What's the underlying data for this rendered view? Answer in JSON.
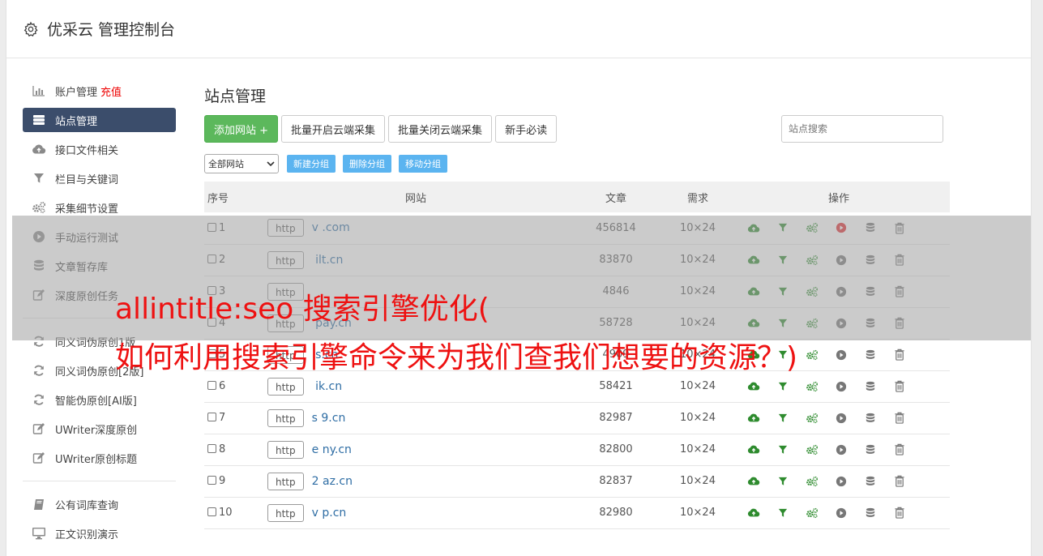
{
  "header": {
    "title": "优采云 管理控制台",
    "icon": "gear-icon"
  },
  "sidebar": {
    "items": [
      {
        "label": "账户管理",
        "extra": "充值",
        "icon": "bar-chart-icon"
      },
      {
        "label": "站点管理",
        "icon": "server-icon",
        "active": true
      },
      {
        "label": "接口文件相关",
        "icon": "cloud-upload-icon"
      },
      {
        "label": "栏目与关键词",
        "icon": "filter-icon"
      },
      {
        "label": "采集细节设置",
        "icon": "gears-icon"
      },
      {
        "label": "手动运行测试",
        "icon": "play-icon"
      },
      {
        "label": "文章暂存库",
        "icon": "database-icon"
      },
      {
        "label": "深度原创任务",
        "icon": "edit-icon"
      }
    ],
    "items2": [
      {
        "label": "同义词伪原创1版",
        "icon": "refresh-icon"
      },
      {
        "label": "同义词伪原创[2版]",
        "icon": "refresh-icon"
      },
      {
        "label": "智能伪原创[AI版]",
        "icon": "refresh-icon"
      },
      {
        "label": "UWriter深度原创",
        "icon": "edit-icon"
      },
      {
        "label": "UWriter原创标题",
        "icon": "edit-icon"
      }
    ],
    "items3": [
      {
        "label": "公有词库查询",
        "icon": "book-icon"
      },
      {
        "label": "正文识别演示",
        "icon": "monitor-icon"
      }
    ]
  },
  "main": {
    "title": "站点管理",
    "toolbar": {
      "add_site": "添加网站 +",
      "batch_open": "批量开启云端采集",
      "batch_close": "批量关闭云端采集",
      "guide": "新手必读",
      "search_placeholder": "站点搜索"
    },
    "group": {
      "select_value": "全部网站",
      "new_group": "新建分组",
      "delete_group": "删除分组",
      "move_group": "移动分组"
    },
    "table": {
      "headers": {
        "num": "序号",
        "site": "网站",
        "articles": "文章",
        "demand": "需求",
        "ops": "操作"
      },
      "rows": [
        {
          "num": "1",
          "proto": "http",
          "site": "v              .com",
          "articles": "456814",
          "demand": "10×24",
          "running": true
        },
        {
          "num": "2",
          "proto": "http",
          "site": "      ilt.cn",
          "articles": "83870",
          "demand": "10×24",
          "running": false
        },
        {
          "num": "3",
          "proto": "http",
          "site": "",
          "articles": "4846",
          "demand": "10×24",
          "running": false
        },
        {
          "num": "4",
          "proto": "http",
          "site": "         pay.cn",
          "articles": "58728",
          "demand": "10×24",
          "running": false
        },
        {
          "num": "5",
          "proto": "http",
          "site": "        s.cn",
          "articles": "4909",
          "demand": "10×24",
          "running": false
        },
        {
          "num": "6",
          "proto": "http",
          "site": "       ik.cn",
          "articles": "58421",
          "demand": "10×24",
          "running": false
        },
        {
          "num": "7",
          "proto": "http",
          "site": "s     9.cn",
          "articles": "82987",
          "demand": "10×24",
          "running": false
        },
        {
          "num": "8",
          "proto": "http",
          "site": "e       ny.cn",
          "articles": "82800",
          "demand": "10×24",
          "running": false
        },
        {
          "num": "9",
          "proto": "http",
          "site": "2       az.cn",
          "articles": "82837",
          "demand": "10×24",
          "running": false
        },
        {
          "num": "10",
          "proto": "http",
          "site": "v      p.cn",
          "articles": "82980",
          "demand": "10×24",
          "running": false
        }
      ]
    }
  },
  "overlay": {
    "line1": "allintitle:seo 搜索引擎优化(",
    "line2": "如何利用搜索引擎命令来为我们查我们想要的资源？)"
  },
  "colors": {
    "accent": "#3b4d6b",
    "green": "#5cb85c",
    "blue_btn": "#5bb4f0",
    "link": "#2e6da4",
    "overlay_text": "#ee1111"
  }
}
